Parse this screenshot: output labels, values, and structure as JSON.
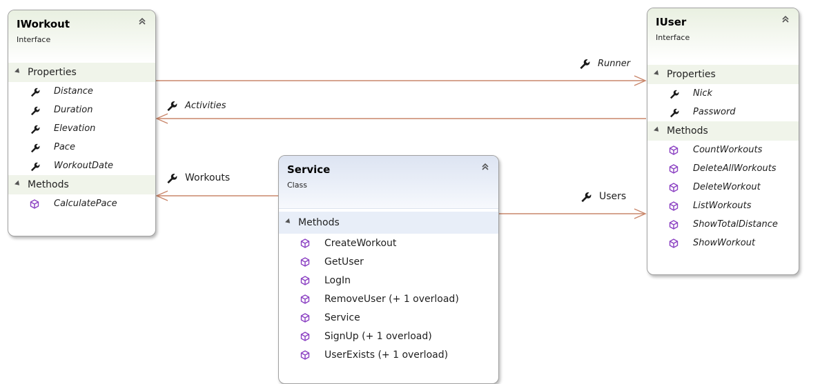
{
  "iworkout": {
    "title": "IWorkout",
    "stereotype": "Interface",
    "properties_label": "Properties",
    "properties": [
      "Distance",
      "Duration",
      "Elevation",
      "Pace",
      "WorkoutDate"
    ],
    "methods_label": "Methods",
    "methods": [
      "CalculatePace"
    ]
  },
  "iuser": {
    "title": "IUser",
    "stereotype": "Interface",
    "properties_label": "Properties",
    "properties": [
      "Nick",
      "Password"
    ],
    "methods_label": "Methods",
    "methods": [
      "CountWorkouts",
      "DeleteAllWorkouts",
      "DeleteWorkout",
      "ListWorkouts",
      "ShowTotalDistance",
      "ShowWorkout"
    ]
  },
  "service": {
    "title": "Service",
    "stereotype": "Class",
    "methods_label": "Methods",
    "methods": [
      "CreateWorkout",
      "GetUser",
      "LogIn",
      "RemoveUser (+ 1 overload)",
      "Service",
      "SignUp (+ 1 overload)",
      "UserExists (+ 1 overload)"
    ]
  },
  "connectors": {
    "runner": "Runner",
    "activities": "Activities",
    "workouts": "Workouts",
    "users": "Users"
  },
  "colors": {
    "connector": "#c9866a",
    "method_icon": "#8a3fc2",
    "property_icon": "#1a1a1a",
    "interface_header": "#e9f0e1",
    "class_header": "#dde4f2"
  },
  "icons": {
    "property": "wrench-icon",
    "method": "cube-icon",
    "collapse": "double-chevron-up-icon",
    "section_toggle": "triangle-expanded-icon"
  }
}
